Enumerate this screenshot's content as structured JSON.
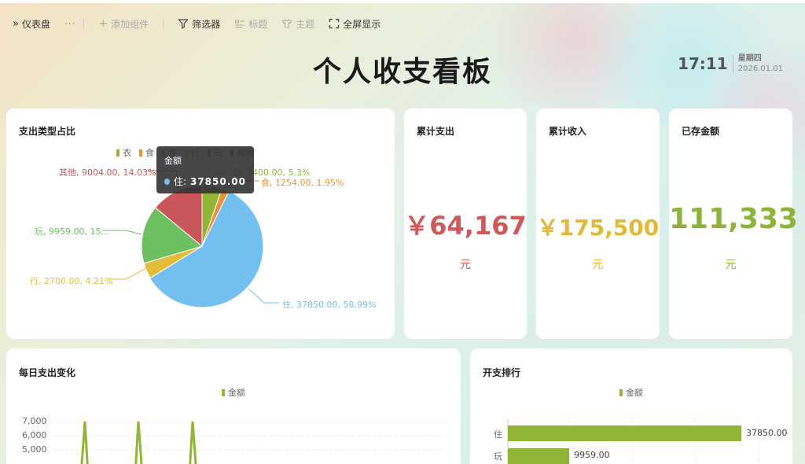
{
  "toolbar": {
    "dashboard_label": "仪表盘",
    "more": "···",
    "add_widget": "添加组件",
    "filter": "筛选器",
    "title_item": "标题",
    "theme": "主题",
    "fullscreen": "全屏显示"
  },
  "page": {
    "title": "个人收支看板"
  },
  "clock": {
    "time": "17:11",
    "weekday": "星期四",
    "date": "2026.01.01"
  },
  "pie_card": {
    "title": "支出类型占比",
    "legend": [
      {
        "name": "衣",
        "color": "#91b537"
      },
      {
        "name": "食",
        "color": "#e8923a"
      },
      {
        "name": "住",
        "color": "#73c0f0"
      },
      {
        "name": "行",
        "color": "#e3bd3a"
      },
      {
        "name": "玩",
        "color": "#6cc060"
      },
      {
        "name": "其他",
        "color": "#c8565a"
      }
    ],
    "labels": {
      "other": "其他, 9004.00, 14.03%",
      "cloth": "衣, 3400.00, 5.3%",
      "food": "食, 1254.00, 1.95%",
      "play": "玩, 9959.00, 15...",
      "travel": "行, 2700.00, 4.21%",
      "house": "住, 37850.00, 58.99%"
    },
    "tooltip": {
      "title": "金额",
      "series": "住:",
      "value": "37850.00"
    }
  },
  "chart_data": [
    {
      "type": "pie",
      "title": "支出类型占比",
      "categories": [
        "衣",
        "食",
        "住",
        "行",
        "玩",
        "其他"
      ],
      "values": [
        3400.0,
        1254.0,
        37850.0,
        2700.0,
        9959.0,
        9004.0
      ],
      "percent": [
        5.3,
        1.95,
        58.99,
        4.21,
        15.52,
        14.03
      ],
      "colors": [
        "#91b537",
        "#e8923a",
        "#73c0f0",
        "#e3bd3a",
        "#6cc060",
        "#c8565a"
      ],
      "legend": "top"
    },
    {
      "type": "line",
      "title": "每日支出变化",
      "series": [
        {
          "name": "金额"
        }
      ],
      "y_ticks": [
        "5,000",
        "6,000",
        "7,000"
      ]
    },
    {
      "type": "bar",
      "title": "开支排行",
      "series": [
        {
          "name": "金额"
        }
      ],
      "categories": [
        "住",
        "玩"
      ],
      "values": [
        37850.0,
        9959.0
      ],
      "labels": [
        "37850.00",
        "9959.00"
      ]
    }
  ],
  "kpis": [
    {
      "title": "累计支出",
      "value": "￥64,167",
      "unit": "元",
      "color": "#d0585a"
    },
    {
      "title": "累计收入",
      "value": "￥175,500",
      "unit": "元",
      "color": "#e0b93b"
    },
    {
      "title": "已存金额",
      "value": "111,333",
      "unit": "元",
      "color": "#8db43a"
    }
  ],
  "line_card": {
    "title": "每日支出变化",
    "legend": "金额",
    "ticks": [
      "7,000",
      "6,000",
      "5,000"
    ]
  },
  "bar_card": {
    "title": "开支排行",
    "legend": "金额",
    "cats": [
      "住",
      "玩"
    ],
    "labels": [
      "37850.00",
      "9959.00"
    ]
  }
}
